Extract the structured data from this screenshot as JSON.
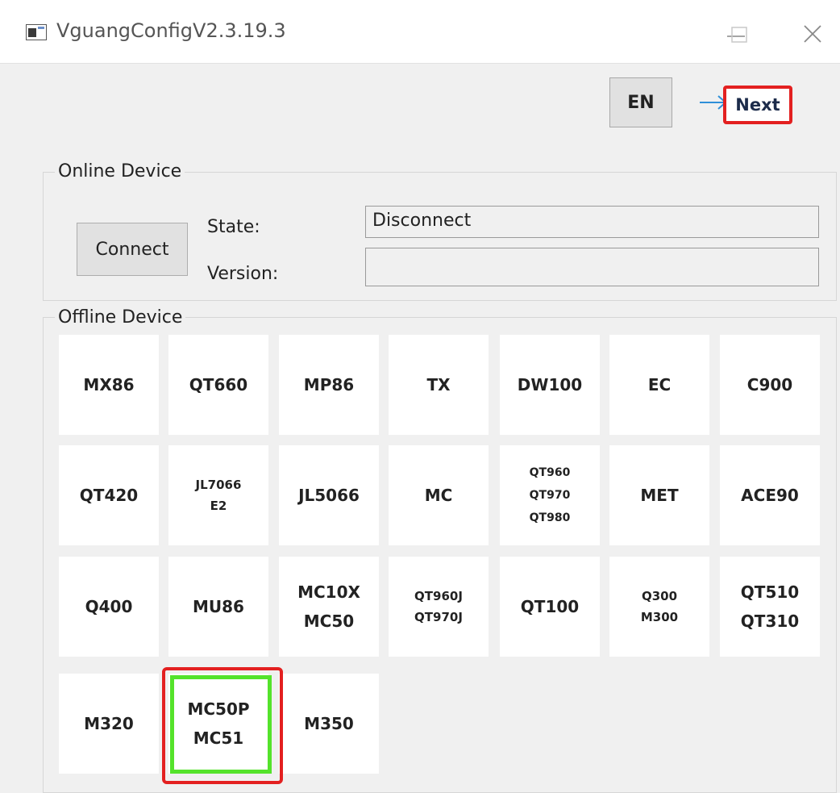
{
  "window": {
    "title": "VguangConfigV2.3.19.3",
    "icons": {
      "app": "app-icon",
      "minimize": "minimize-icon",
      "maximize": "maximize-icon",
      "close": "close-icon"
    }
  },
  "toolbar": {
    "language_label": "EN",
    "next_label": "Next",
    "next_arrow_icon": "arrow-right-icon",
    "highlight_color": "#e32020"
  },
  "online_device": {
    "group_title": "Online Device",
    "connect_label": "Connect",
    "state_label": "State:",
    "state_value": "Disconnect",
    "version_label": "Version:",
    "version_value": ""
  },
  "offline_device": {
    "group_title": "Offline Device",
    "selected_highlight_color": "#54e32b",
    "tiles": [
      {
        "lines": [
          "MX86"
        ]
      },
      {
        "lines": [
          "QT660"
        ]
      },
      {
        "lines": [
          "MP86"
        ]
      },
      {
        "lines": [
          "TX"
        ]
      },
      {
        "lines": [
          "DW100"
        ]
      },
      {
        "lines": [
          "EC"
        ]
      },
      {
        "lines": [
          "C900"
        ]
      },
      {
        "lines": [
          "QT420"
        ]
      },
      {
        "lines": [
          "JL7066",
          "E2"
        ]
      },
      {
        "lines": [
          "JL5066"
        ]
      },
      {
        "lines": [
          "MC"
        ]
      },
      {
        "lines": [
          "QT960",
          "QT970",
          "QT980"
        ]
      },
      {
        "lines": [
          "MET"
        ]
      },
      {
        "lines": [
          "ACE90"
        ]
      },
      {
        "lines": [
          "Q400"
        ]
      },
      {
        "lines": [
          "MU86"
        ]
      },
      {
        "lines": [
          "MC10X",
          "MC50"
        ]
      },
      {
        "lines": [
          "QT960J",
          "QT970J"
        ]
      },
      {
        "lines": [
          "QT100"
        ]
      },
      {
        "lines": [
          "Q300",
          "M300"
        ]
      },
      {
        "lines": [
          "QT510",
          "QT310"
        ]
      },
      {
        "lines": [
          "M320"
        ]
      },
      {
        "lines": [
          "MC50P",
          "MC51"
        ]
      },
      {
        "lines": [
          "M350"
        ]
      }
    ]
  }
}
